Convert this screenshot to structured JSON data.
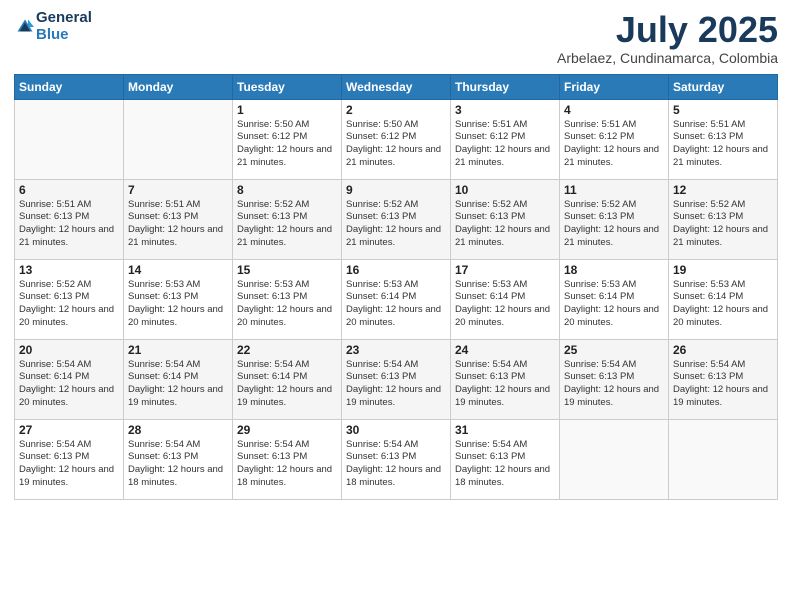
{
  "header": {
    "logo_general": "General",
    "logo_blue": "Blue",
    "month_title": "July 2025",
    "location": "Arbelaez, Cundinamarca, Colombia"
  },
  "days_of_week": [
    "Sunday",
    "Monday",
    "Tuesday",
    "Wednesday",
    "Thursday",
    "Friday",
    "Saturday"
  ],
  "weeks": [
    [
      {
        "day": "",
        "sunrise": "",
        "sunset": "",
        "daylight": ""
      },
      {
        "day": "",
        "sunrise": "",
        "sunset": "",
        "daylight": ""
      },
      {
        "day": "1",
        "sunrise": "Sunrise: 5:50 AM",
        "sunset": "Sunset: 6:12 PM",
        "daylight": "Daylight: 12 hours and 21 minutes."
      },
      {
        "day": "2",
        "sunrise": "Sunrise: 5:50 AM",
        "sunset": "Sunset: 6:12 PM",
        "daylight": "Daylight: 12 hours and 21 minutes."
      },
      {
        "day": "3",
        "sunrise": "Sunrise: 5:51 AM",
        "sunset": "Sunset: 6:12 PM",
        "daylight": "Daylight: 12 hours and 21 minutes."
      },
      {
        "day": "4",
        "sunrise": "Sunrise: 5:51 AM",
        "sunset": "Sunset: 6:12 PM",
        "daylight": "Daylight: 12 hours and 21 minutes."
      },
      {
        "day": "5",
        "sunrise": "Sunrise: 5:51 AM",
        "sunset": "Sunset: 6:13 PM",
        "daylight": "Daylight: 12 hours and 21 minutes."
      }
    ],
    [
      {
        "day": "6",
        "sunrise": "Sunrise: 5:51 AM",
        "sunset": "Sunset: 6:13 PM",
        "daylight": "Daylight: 12 hours and 21 minutes."
      },
      {
        "day": "7",
        "sunrise": "Sunrise: 5:51 AM",
        "sunset": "Sunset: 6:13 PM",
        "daylight": "Daylight: 12 hours and 21 minutes."
      },
      {
        "day": "8",
        "sunrise": "Sunrise: 5:52 AM",
        "sunset": "Sunset: 6:13 PM",
        "daylight": "Daylight: 12 hours and 21 minutes."
      },
      {
        "day": "9",
        "sunrise": "Sunrise: 5:52 AM",
        "sunset": "Sunset: 6:13 PM",
        "daylight": "Daylight: 12 hours and 21 minutes."
      },
      {
        "day": "10",
        "sunrise": "Sunrise: 5:52 AM",
        "sunset": "Sunset: 6:13 PM",
        "daylight": "Daylight: 12 hours and 21 minutes."
      },
      {
        "day": "11",
        "sunrise": "Sunrise: 5:52 AM",
        "sunset": "Sunset: 6:13 PM",
        "daylight": "Daylight: 12 hours and 21 minutes."
      },
      {
        "day": "12",
        "sunrise": "Sunrise: 5:52 AM",
        "sunset": "Sunset: 6:13 PM",
        "daylight": "Daylight: 12 hours and 21 minutes."
      }
    ],
    [
      {
        "day": "13",
        "sunrise": "Sunrise: 5:52 AM",
        "sunset": "Sunset: 6:13 PM",
        "daylight": "Daylight: 12 hours and 20 minutes."
      },
      {
        "day": "14",
        "sunrise": "Sunrise: 5:53 AM",
        "sunset": "Sunset: 6:13 PM",
        "daylight": "Daylight: 12 hours and 20 minutes."
      },
      {
        "day": "15",
        "sunrise": "Sunrise: 5:53 AM",
        "sunset": "Sunset: 6:13 PM",
        "daylight": "Daylight: 12 hours and 20 minutes."
      },
      {
        "day": "16",
        "sunrise": "Sunrise: 5:53 AM",
        "sunset": "Sunset: 6:14 PM",
        "daylight": "Daylight: 12 hours and 20 minutes."
      },
      {
        "day": "17",
        "sunrise": "Sunrise: 5:53 AM",
        "sunset": "Sunset: 6:14 PM",
        "daylight": "Daylight: 12 hours and 20 minutes."
      },
      {
        "day": "18",
        "sunrise": "Sunrise: 5:53 AM",
        "sunset": "Sunset: 6:14 PM",
        "daylight": "Daylight: 12 hours and 20 minutes."
      },
      {
        "day": "19",
        "sunrise": "Sunrise: 5:53 AM",
        "sunset": "Sunset: 6:14 PM",
        "daylight": "Daylight: 12 hours and 20 minutes."
      }
    ],
    [
      {
        "day": "20",
        "sunrise": "Sunrise: 5:54 AM",
        "sunset": "Sunset: 6:14 PM",
        "daylight": "Daylight: 12 hours and 20 minutes."
      },
      {
        "day": "21",
        "sunrise": "Sunrise: 5:54 AM",
        "sunset": "Sunset: 6:14 PM",
        "daylight": "Daylight: 12 hours and 19 minutes."
      },
      {
        "day": "22",
        "sunrise": "Sunrise: 5:54 AM",
        "sunset": "Sunset: 6:14 PM",
        "daylight": "Daylight: 12 hours and 19 minutes."
      },
      {
        "day": "23",
        "sunrise": "Sunrise: 5:54 AM",
        "sunset": "Sunset: 6:13 PM",
        "daylight": "Daylight: 12 hours and 19 minutes."
      },
      {
        "day": "24",
        "sunrise": "Sunrise: 5:54 AM",
        "sunset": "Sunset: 6:13 PM",
        "daylight": "Daylight: 12 hours and 19 minutes."
      },
      {
        "day": "25",
        "sunrise": "Sunrise: 5:54 AM",
        "sunset": "Sunset: 6:13 PM",
        "daylight": "Daylight: 12 hours and 19 minutes."
      },
      {
        "day": "26",
        "sunrise": "Sunrise: 5:54 AM",
        "sunset": "Sunset: 6:13 PM",
        "daylight": "Daylight: 12 hours and 19 minutes."
      }
    ],
    [
      {
        "day": "27",
        "sunrise": "Sunrise: 5:54 AM",
        "sunset": "Sunset: 6:13 PM",
        "daylight": "Daylight: 12 hours and 19 minutes."
      },
      {
        "day": "28",
        "sunrise": "Sunrise: 5:54 AM",
        "sunset": "Sunset: 6:13 PM",
        "daylight": "Daylight: 12 hours and 18 minutes."
      },
      {
        "day": "29",
        "sunrise": "Sunrise: 5:54 AM",
        "sunset": "Sunset: 6:13 PM",
        "daylight": "Daylight: 12 hours and 18 minutes."
      },
      {
        "day": "30",
        "sunrise": "Sunrise: 5:54 AM",
        "sunset": "Sunset: 6:13 PM",
        "daylight": "Daylight: 12 hours and 18 minutes."
      },
      {
        "day": "31",
        "sunrise": "Sunrise: 5:54 AM",
        "sunset": "Sunset: 6:13 PM",
        "daylight": "Daylight: 12 hours and 18 minutes."
      },
      {
        "day": "",
        "sunrise": "",
        "sunset": "",
        "daylight": ""
      },
      {
        "day": "",
        "sunrise": "",
        "sunset": "",
        "daylight": ""
      }
    ]
  ]
}
